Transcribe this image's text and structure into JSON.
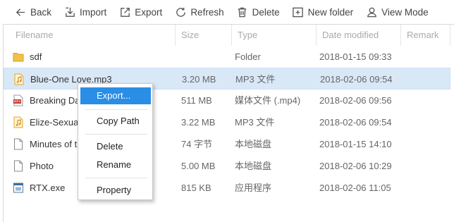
{
  "toolbar": {
    "back": "Back",
    "import": "Import",
    "export": "Export",
    "refresh": "Refresh",
    "delete": "Delete",
    "new_folder": "New folder",
    "view_mode": "View Mode"
  },
  "columns": {
    "filename": "Filename",
    "size": "Size",
    "type": "Type",
    "date": "Date modified",
    "remark": "Remark"
  },
  "files": [
    {
      "name": "sdf",
      "size": "",
      "type": "Folder",
      "date": "2018-01-15 09:33",
      "icon": "folder-icon"
    },
    {
      "name": "Blue-One Love.mp3",
      "size": "3.20 MB",
      "type": "MP3 文件",
      "date": "2018-02-06 09:54",
      "icon": "music-file-icon"
    },
    {
      "name": "Breaking Da",
      "size": "511 MB",
      "type": "媒体文件 (.mp4)",
      "date": "2018-02-06 09:56",
      "icon": "video-file-icon"
    },
    {
      "name": "Elize-Sexual",
      "size": "3.22 MB",
      "type": "MP3 文件",
      "date": "2018-02-06 09:54",
      "icon": "music-file-icon"
    },
    {
      "name": "Minutes of t",
      "size": "74 字节",
      "type": "本地磁盘",
      "date": "2018-01-15 14:10",
      "icon": "document-icon"
    },
    {
      "name": "Photo",
      "size": "5.00 MB",
      "type": "本地磁盘",
      "date": "2018-02-06 10:29",
      "icon": "document-icon"
    },
    {
      "name": "RTX.exe",
      "size": "815 KB",
      "type": "应用程序",
      "date": "2018-02-06 11:05",
      "icon": "application-icon"
    }
  ],
  "context_menu": {
    "export": "Export...",
    "copy_path": "Copy Path",
    "delete": "Delete",
    "rename": "Rename",
    "property": "Property"
  }
}
